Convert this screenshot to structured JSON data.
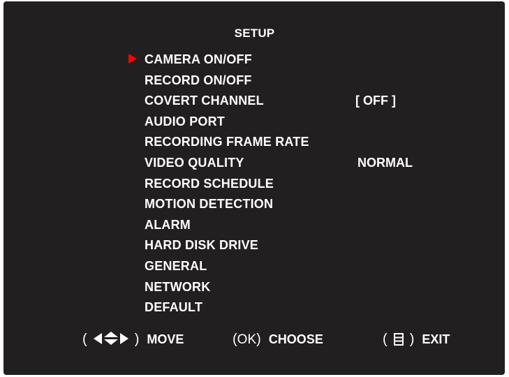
{
  "screen": {
    "title": "SETUP",
    "selected_index": 0
  },
  "menu": [
    {
      "label": "CAMERA ON/OFF",
      "value": ""
    },
    {
      "label": "RECORD ON/OFF",
      "value": ""
    },
    {
      "label": "COVERT CHANNEL",
      "value": "[ OFF ]"
    },
    {
      "label": "AUDIO PORT",
      "value": ""
    },
    {
      "label": "RECORDING FRAME RATE",
      "value": ""
    },
    {
      "label": "VIDEO QUALITY",
      "value": "NORMAL"
    },
    {
      "label": "RECORD SCHEDULE",
      "value": ""
    },
    {
      "label": "MOTION DETECTION",
      "value": ""
    },
    {
      "label": "ALARM",
      "value": ""
    },
    {
      "label": "HARD DISK DRIVE",
      "value": ""
    },
    {
      "label": "GENERAL",
      "value": ""
    },
    {
      "label": "NETWORK",
      "value": ""
    },
    {
      "label": "DEFAULT",
      "value": ""
    }
  ],
  "footer": {
    "move": {
      "open": "(",
      "icon": "arrow-keys-icon",
      "close": ")",
      "label": "MOVE"
    },
    "choose": {
      "open": "(",
      "key": "OK",
      "close": ")",
      "label": "CHOOSE"
    },
    "exit": {
      "open": "(",
      "icon": "menu-key-icon",
      "close": ")",
      "label": "EXIT"
    }
  },
  "colors": {
    "background": "#221f20",
    "text": "#ffffff",
    "cursor": "#ff0000"
  }
}
